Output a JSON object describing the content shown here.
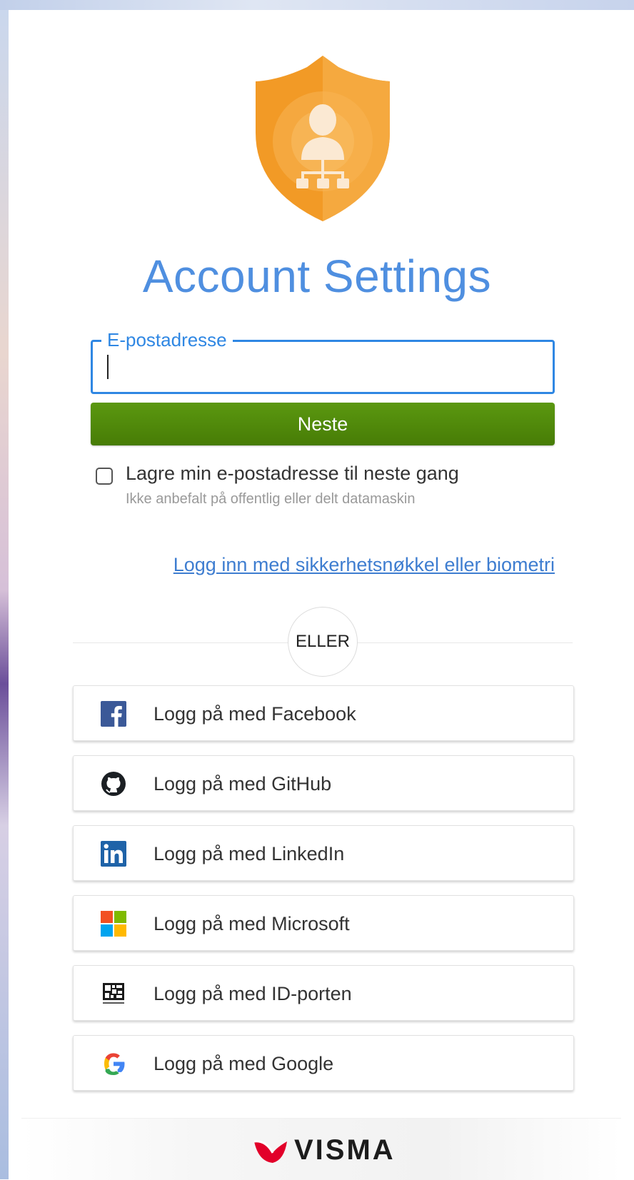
{
  "header": {
    "title": "Account Settings",
    "logo_icon": "shield-user-network-icon"
  },
  "login_form": {
    "email_label": "E-postadresse",
    "email_value": "",
    "next_label": "Neste",
    "remember_label": "Lagre min e-postadresse til neste gang",
    "remember_hint": "Ikke anbefalt på offentlig eller delt datamaskin",
    "remember_checked": false,
    "security_key_link": "Logg inn med sikkerhetsnøkkel eller biometri"
  },
  "divider": {
    "text": "ELLER"
  },
  "providers": [
    {
      "label": "Logg på med Facebook",
      "icon": "facebook-icon"
    },
    {
      "label": "Logg på med GitHub",
      "icon": "github-icon"
    },
    {
      "label": "Logg på med LinkedIn",
      "icon": "linkedin-icon"
    },
    {
      "label": "Logg på med Microsoft",
      "icon": "microsoft-icon"
    },
    {
      "label": "Logg på med ID-porten",
      "icon": "id-porten-icon"
    },
    {
      "label": "Logg på med Google",
      "icon": "google-icon"
    }
  ],
  "footer": {
    "brand": "VISMA"
  },
  "colors": {
    "accent_blue": "#2f87e3",
    "title_blue": "#4f8fe0",
    "button_green": "#4f8a0b",
    "shield_orange": "#f19a2a",
    "link_blue": "#3e7dd0",
    "visma_red": "#e2002a"
  }
}
